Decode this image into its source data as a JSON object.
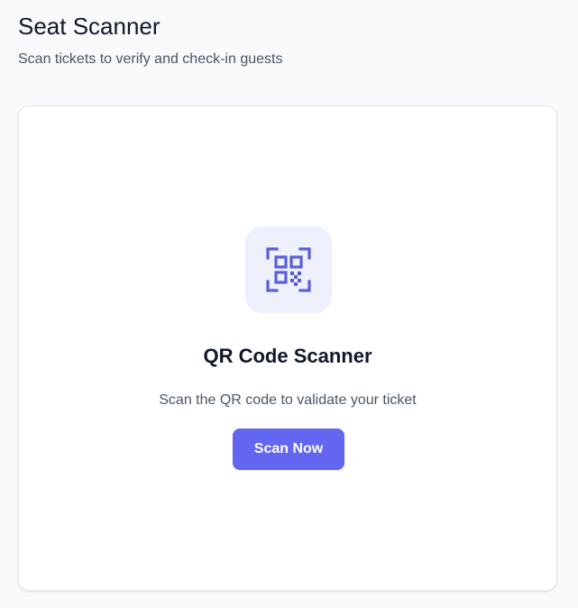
{
  "header": {
    "title": "Seat Scanner",
    "subtitle": "Scan tickets to verify and check-in guests"
  },
  "scanner": {
    "icon": "qr-code-icon",
    "title": "QR Code Scanner",
    "description": "Scan the QR code to validate your ticket",
    "button_label": "Scan Now"
  },
  "colors": {
    "accent": "#6366f1",
    "icon_tile_bg": "#eef0fb",
    "icon_color": "#5b5fd6",
    "page_bg": "#f8fafc"
  }
}
